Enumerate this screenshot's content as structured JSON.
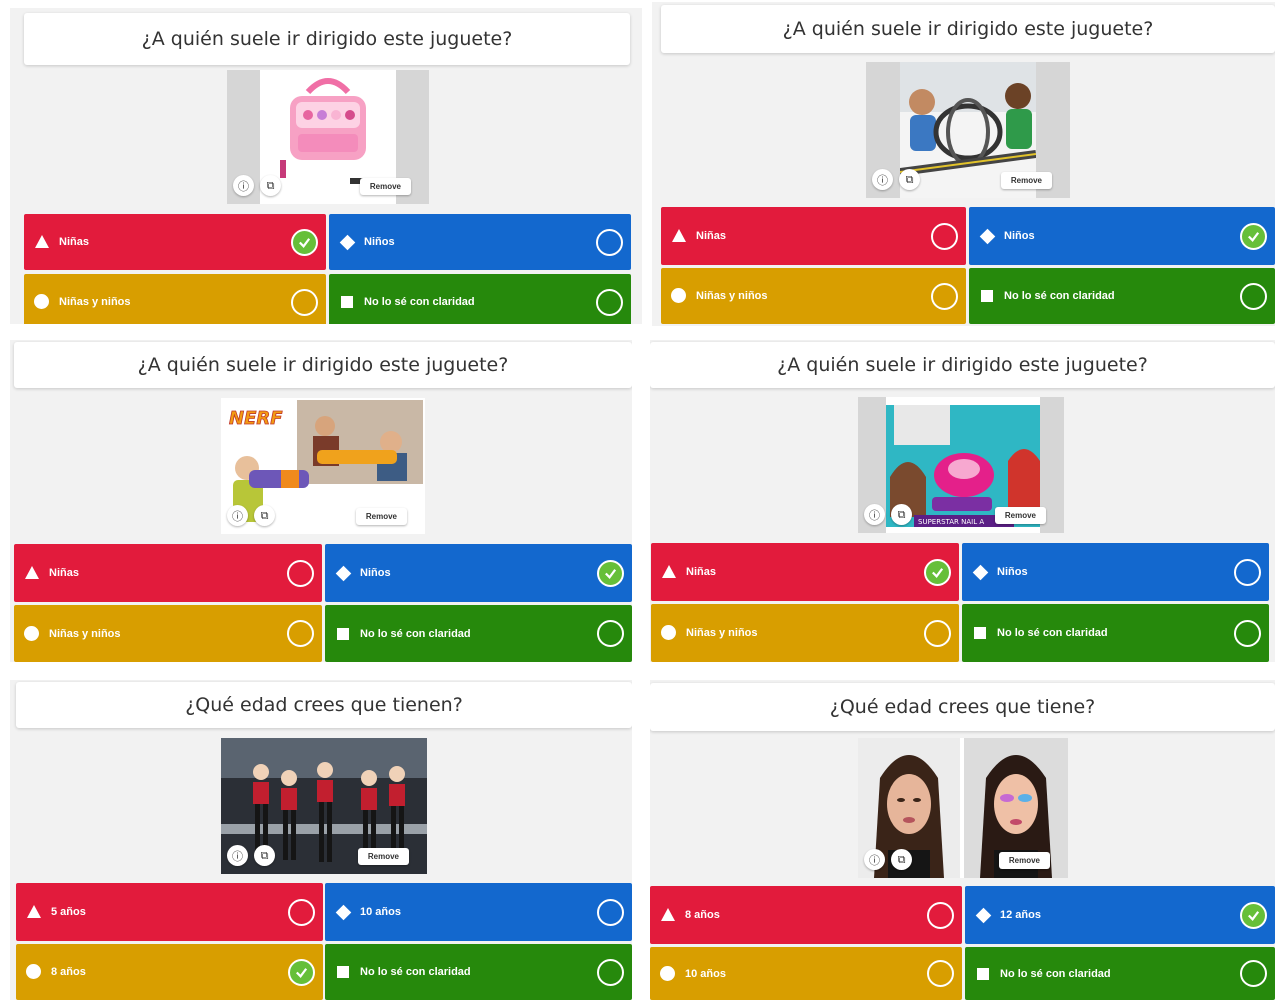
{
  "colors": {
    "red": "#e21b3c",
    "blue": "#1368ce",
    "yellow": "#d89e00",
    "green": "#26890c",
    "check": "#66bf39"
  },
  "media_controls": {
    "info_icon": "ⓘ",
    "crop_icon": "⧉",
    "remove_label": "Remove"
  },
  "panels": [
    {
      "question": "¿A quién suele ir dirigido este juguete?",
      "image": "pink-makeup-case",
      "answers": [
        {
          "shape": "triangle",
          "label": "Niñas",
          "correct": true
        },
        {
          "shape": "diamond",
          "label": "Niños",
          "correct": false
        },
        {
          "shape": "circle",
          "label": "Niñas y niños",
          "correct": false
        },
        {
          "shape": "square",
          "label": "No lo sé con claridad",
          "correct": false
        }
      ]
    },
    {
      "question": "¿A quién suele ir dirigido este juguete?",
      "image": "race-track-boys",
      "answers": [
        {
          "shape": "triangle",
          "label": "Niñas",
          "correct": false
        },
        {
          "shape": "diamond",
          "label": "Niños",
          "correct": true
        },
        {
          "shape": "circle",
          "label": "Niñas y niños",
          "correct": false
        },
        {
          "shape": "square",
          "label": "No lo sé con claridad",
          "correct": false
        }
      ]
    },
    {
      "question": "¿A quién suele ir dirigido este juguete?",
      "image": "nerf-blaster",
      "image_text": "NERF",
      "answers": [
        {
          "shape": "triangle",
          "label": "Niñas",
          "correct": false
        },
        {
          "shape": "diamond",
          "label": "Niños",
          "correct": true
        },
        {
          "shape": "circle",
          "label": "Niñas y niños",
          "correct": false
        },
        {
          "shape": "square",
          "label": "No lo sé con claridad",
          "correct": false
        }
      ]
    },
    {
      "question": "¿A quién suele ir dirigido este juguete?",
      "image": "nail-art-kit",
      "image_text": "SUPERSTAR NAIL A",
      "answers": [
        {
          "shape": "triangle",
          "label": "Niñas",
          "correct": true
        },
        {
          "shape": "diamond",
          "label": "Niños",
          "correct": false
        },
        {
          "shape": "circle",
          "label": "Niñas y niños",
          "correct": false
        },
        {
          "shape": "square",
          "label": "No lo sé con claridad",
          "correct": false
        }
      ]
    },
    {
      "question": "¿Qué edad crees que tienen?",
      "image": "dance-group",
      "answers": [
        {
          "shape": "triangle",
          "label": "5 años",
          "correct": false
        },
        {
          "shape": "diamond",
          "label": "10 años",
          "correct": false
        },
        {
          "shape": "circle",
          "label": "8 años",
          "correct": true
        },
        {
          "shape": "square",
          "label": "No lo sé con claridad",
          "correct": false
        }
      ]
    },
    {
      "question": "¿Qué edad crees que tiene?",
      "image": "makeup-girl-portraits",
      "answers": [
        {
          "shape": "triangle",
          "label": "8 años",
          "correct": false
        },
        {
          "shape": "diamond",
          "label": "12 años",
          "correct": true
        },
        {
          "shape": "circle",
          "label": "10 años",
          "correct": false
        },
        {
          "shape": "square",
          "label": "No lo sé con claridad",
          "correct": false
        }
      ]
    }
  ]
}
